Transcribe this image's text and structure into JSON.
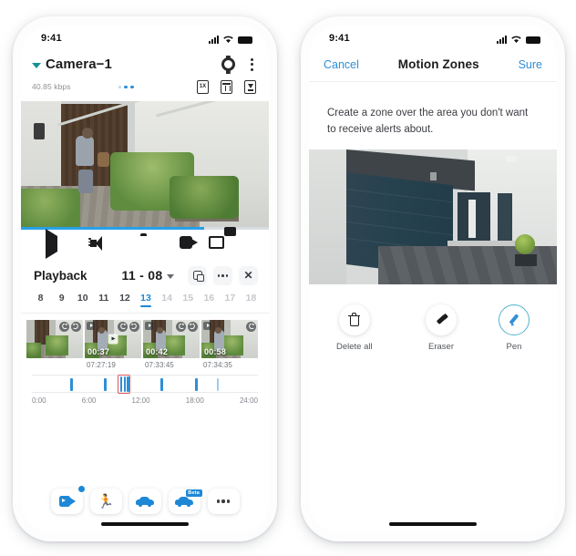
{
  "left_phone": {
    "status_bar": {
      "time": "9:41",
      "signal_icon": "cellular-bars-icon",
      "wifi_icon": "wifi-icon",
      "battery_icon": "battery-icon"
    },
    "header": {
      "camera_name": "Camera−1",
      "chevron_icon": "chevron-down-icon",
      "settings_icon": "gear-icon",
      "more_icon": "kebab-menu-icon"
    },
    "sub_bar": {
      "bitrate": "40.85 kbps",
      "quality_icon": "quality-1x-icon",
      "delete_icon": "trash-box-icon",
      "download_icon": "download-box-icon"
    },
    "controls": [
      {
        "name": "play-button",
        "icon": "play-icon"
      },
      {
        "name": "speaker-button",
        "icon": "speaker-icon"
      },
      {
        "name": "snapshot-button",
        "icon": "camera-icon"
      },
      {
        "name": "record-button",
        "icon": "video-camera-icon"
      },
      {
        "name": "switch-view-button",
        "icon": "switch-view-icon"
      }
    ],
    "playback": {
      "title": "Playback",
      "date": "11 - 08",
      "date_chevron_icon": "chevron-down-icon",
      "pip_icon": "picture-in-picture-icon",
      "more_icon": "more-dots-icon",
      "close_icon": "close-x-icon"
    },
    "dates": [
      {
        "label": "8",
        "state": "active"
      },
      {
        "label": "9",
        "state": "active"
      },
      {
        "label": "10",
        "state": "active"
      },
      {
        "label": "11",
        "state": "active"
      },
      {
        "label": "12",
        "state": "active"
      },
      {
        "label": "13",
        "state": "selected"
      },
      {
        "label": "14",
        "state": "disabled"
      },
      {
        "label": "15",
        "state": "disabled"
      },
      {
        "label": "16",
        "state": "disabled"
      },
      {
        "label": "17",
        "state": "disabled"
      },
      {
        "label": "18",
        "state": "disabled"
      }
    ],
    "clips": [
      {
        "duration": "",
        "timestamp": "",
        "back_icon": "rewind-icon",
        "fwd_icon": "forward-icon"
      },
      {
        "duration": "00:37",
        "timestamp": "07:27:19",
        "back_icon": "rewind-icon",
        "fwd_icon": "forward-icon"
      },
      {
        "duration": "00:42",
        "timestamp": "07:33:45",
        "back_icon": "rewind-icon",
        "fwd_icon": "forward-icon"
      },
      {
        "duration": "00:58",
        "timestamp": "07:34:35",
        "back_icon": "rewind-icon",
        "fwd_icon": "forward-icon"
      }
    ],
    "timeline": {
      "axis": [
        "0:00",
        "6:00",
        "12:00",
        "18:00",
        "24:00"
      ],
      "markers_pct": [
        17,
        32,
        57,
        72,
        82
      ],
      "cursor_pct": 38
    },
    "bottom_nav": [
      {
        "name": "nav-videos",
        "icon": "video-clip-icon",
        "badge": true,
        "beta": false
      },
      {
        "name": "nav-person",
        "icon": "person-running-icon",
        "badge": false,
        "beta": false
      },
      {
        "name": "nav-vehicle",
        "icon": "car-icon",
        "badge": false,
        "beta": false
      },
      {
        "name": "nav-package",
        "icon": "package-car-icon",
        "badge": false,
        "beta": true,
        "beta_label": "Beta"
      },
      {
        "name": "nav-more",
        "icon": "more-dots-icon",
        "badge": false,
        "beta": false
      }
    ]
  },
  "right_phone": {
    "status_bar": {
      "time": "9:41",
      "signal_icon": "cellular-bars-icon",
      "wifi_icon": "wifi-icon",
      "battery_icon": "battery-icon"
    },
    "nav": {
      "cancel_label": "Cancel",
      "title": "Motion Zones",
      "confirm_label": "Sure"
    },
    "instruction": "Create a zone over the area you don't want to receive alerts about.",
    "tools": [
      {
        "name": "delete-all-tool",
        "label": "Delete all",
        "icon": "trash-icon",
        "selected": false
      },
      {
        "name": "eraser-tool",
        "label": "Eraser",
        "icon": "eraser-icon",
        "selected": false
      },
      {
        "name": "pen-tool",
        "label": "Pen",
        "icon": "pen-icon",
        "selected": true
      }
    ]
  },
  "colors": {
    "accent_blue": "#2f8ed6",
    "teal": "#1a8f96",
    "selected_ring": "#52b3cf",
    "cursor_red": "#e0585a",
    "text_dark": "#1c1c1e",
    "text_muted": "#83878c"
  }
}
